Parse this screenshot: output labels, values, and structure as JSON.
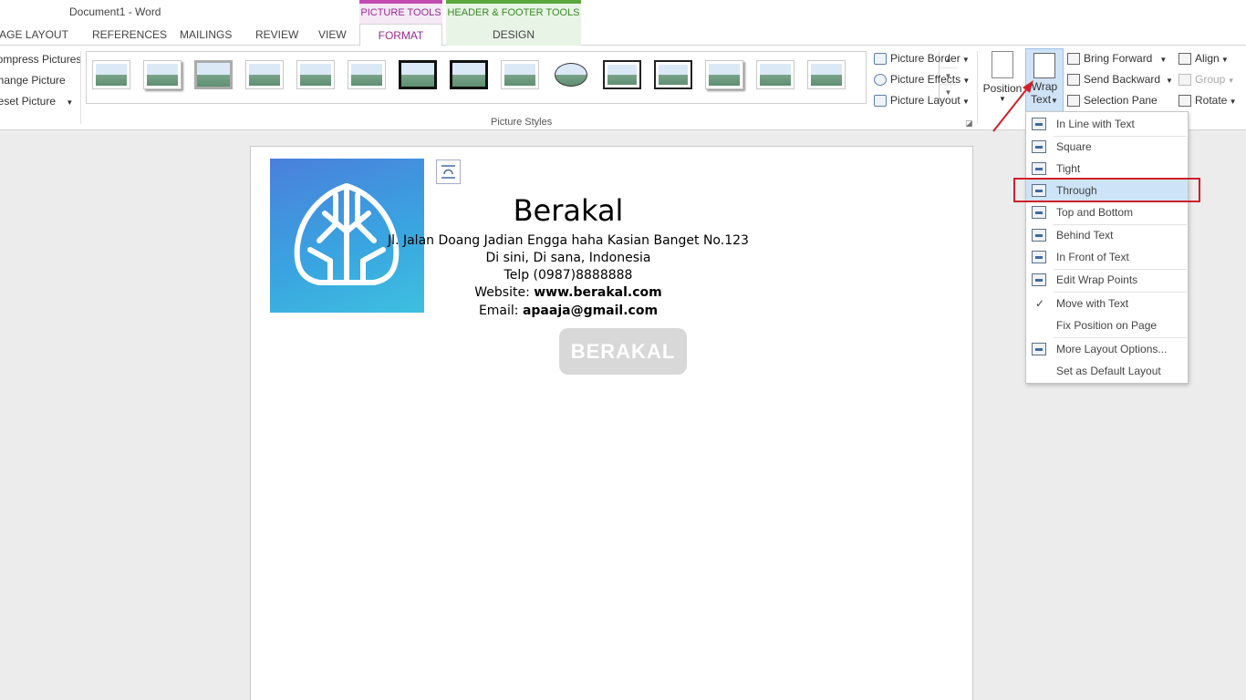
{
  "window": {
    "title": "Document1 - Word"
  },
  "context_tabs": {
    "picture_tools": "PICTURE TOOLS",
    "header_footer_tools": "HEADER & FOOTER TOOLS"
  },
  "tabs": {
    "page_layout": "PAGE LAYOUT",
    "references": "REFERENCES",
    "mailings": "MAILINGS",
    "review": "REVIEW",
    "view": "VIEW",
    "format": "FORMAT",
    "design": "DESIGN"
  },
  "adjust": {
    "compress": "Compress Pictures",
    "change": "Change Picture",
    "reset": "Reset Picture"
  },
  "picture_styles": {
    "label": "Picture Styles"
  },
  "picture_options": {
    "border": "Picture Border",
    "effects": "Picture Effects",
    "layout": "Picture Layout"
  },
  "arrange": {
    "position": "Position",
    "wrap_text_line1": "Wrap",
    "wrap_text_line2": "Text",
    "bring_forward": "Bring Forward",
    "send_backward": "Send Backward",
    "selection_pane": "Selection Pane",
    "align": "Align",
    "group": "Group",
    "rotate": "Rotate"
  },
  "document": {
    "heading": "Berakal",
    "address_line": "Jl. Jalan Doang Jadian Engga haha Kasian Banget No.123",
    "city_line": "Di sini, Di sana, Indonesia",
    "phone_line": "Telp (0987)8888888",
    "website_label": "Website:",
    "website_value": "www.berakal.com",
    "email_label": "Email:",
    "email_value": "apaaja@gmail.com",
    "watermark": "BERAKAL"
  },
  "wrap_menu": {
    "items": [
      "In Line with Text",
      "Square",
      "Tight",
      "Through",
      "Top and Bottom",
      "Behind Text",
      "In Front of Text",
      "Edit Wrap Points",
      "Move with Text",
      "Fix Position on Page",
      "More Layout Options...",
      "Set as Default Layout"
    ],
    "highlighted": "Through",
    "checked": "Move with Text"
  },
  "colors": {
    "picture_tools_accent": "#c24bb0",
    "header_footer_accent": "#5aa73d",
    "highlight_red": "#d01f2a",
    "menu_hover": "#cde3f7"
  }
}
